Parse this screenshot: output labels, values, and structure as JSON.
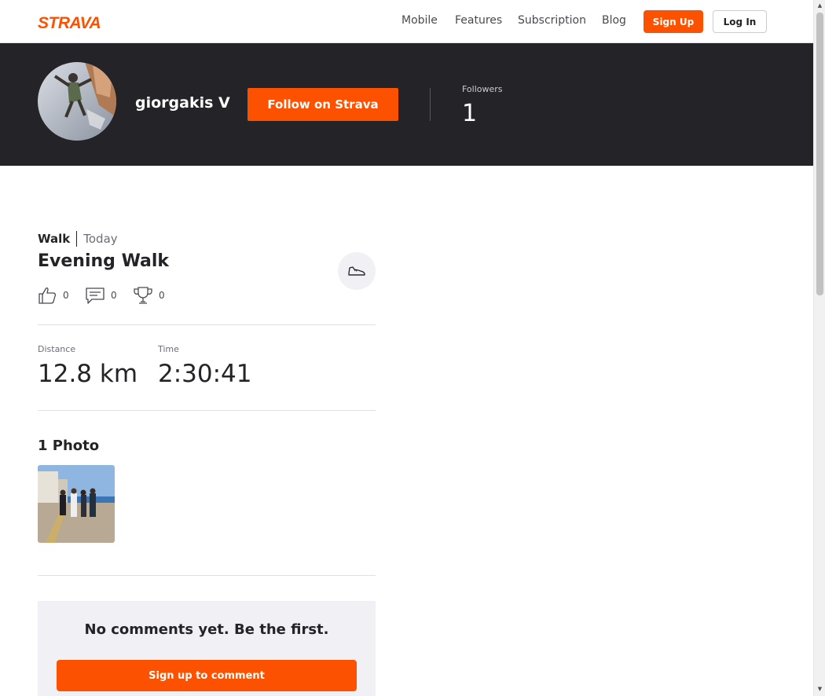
{
  "brand": {
    "logo_text": "STRAVA",
    "accent": "#fc5200"
  },
  "nav": {
    "links": [
      "Mobile",
      "Features",
      "Subscription",
      "Blog"
    ],
    "signup": "Sign Up",
    "login": "Log In"
  },
  "athlete": {
    "name": "giorgakis V",
    "follow": "Follow on Strava",
    "followers_label": "Followers",
    "followers_count": "1"
  },
  "activity": {
    "type": "Walk",
    "when": "Today",
    "title": "Evening Walk",
    "sport_icon": "shoe-icon",
    "kudos": "0",
    "comments": "0",
    "achievements": "0",
    "stats": [
      {
        "label": "Distance",
        "value": "12.8 km"
      },
      {
        "label": "Time",
        "value": "2:30:41"
      }
    ],
    "photos_title": "1 Photo"
  },
  "comments": {
    "empty": "No comments yet. Be the first.",
    "signup": "Sign up to comment"
  }
}
